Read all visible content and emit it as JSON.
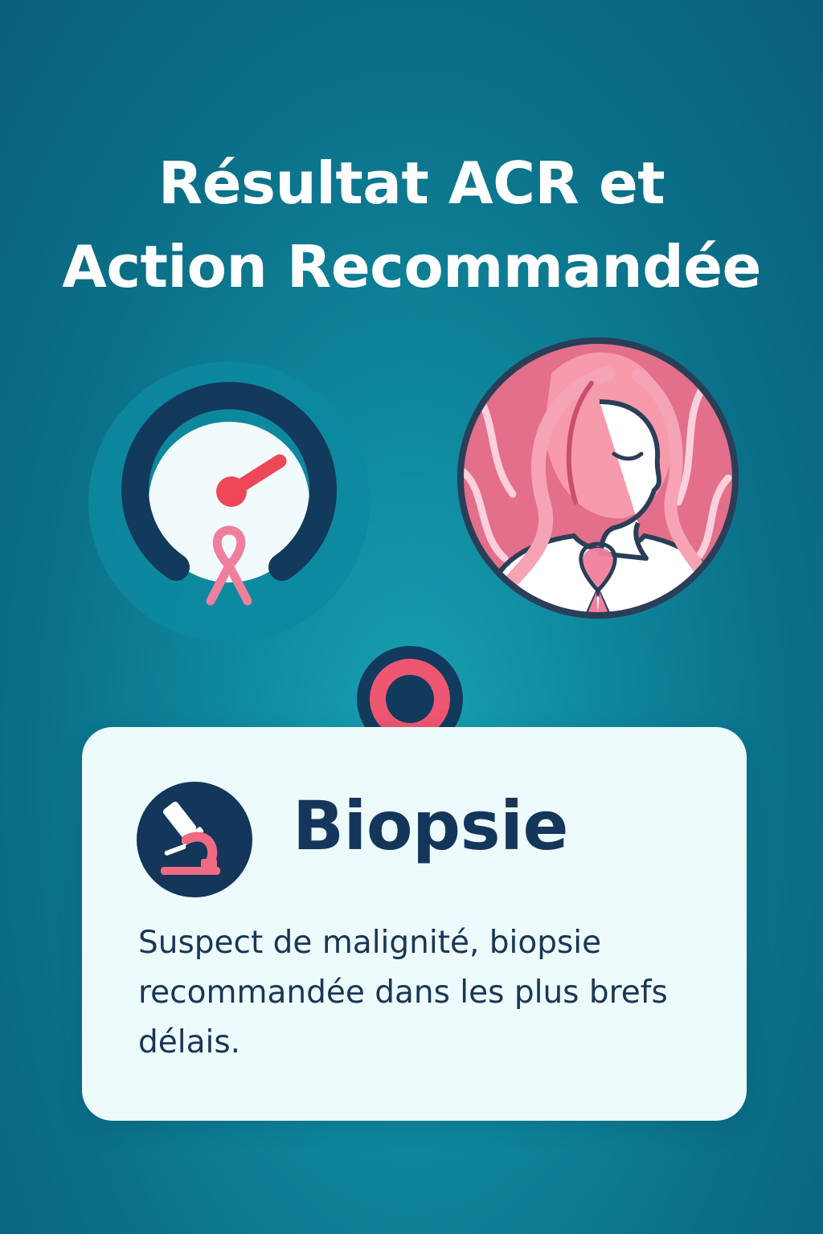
{
  "header": {
    "title_line1": "Résultat ACR et",
    "title_line2": "Action Recommandée"
  },
  "illustrations": {
    "gauge_icon": "gauge-with-ribbon-icon",
    "portrait_icon": "woman-with-pink-ribbon-icon",
    "connector_icon": "target-dot-icon"
  },
  "result_card": {
    "icon": "microscope-icon",
    "title": "Biopsie",
    "description": "Suspect de malignité, biopsie recommandée dans les plus brefs délais."
  },
  "colors": {
    "background_top": "#0a5f7b",
    "background_center": "#1aa2b4",
    "navy": "#13365a",
    "accent_red": "#ef4658",
    "ribbon_pink": "#f08aa6",
    "card_background": "#eefbfd"
  }
}
